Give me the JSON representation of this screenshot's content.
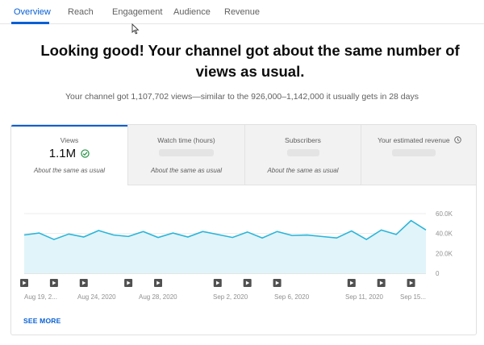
{
  "tabs": [
    {
      "label": "Overview",
      "active": true
    },
    {
      "label": "Reach"
    },
    {
      "label": "Engagement"
    },
    {
      "label": "Audience"
    },
    {
      "label": "Revenue"
    }
  ],
  "headline": "Looking good! Your channel got about the same number of views as usual.",
  "subline": "Your channel got 1,107,702 views—similar to the 926,000–1,142,000 it usually gets in 28 days",
  "metrics": [
    {
      "title": "Views",
      "value": "1.1M",
      "note": "About the same as usual"
    },
    {
      "title": "Watch time (hours)",
      "value": "",
      "note": "About the same as usual"
    },
    {
      "title": "Subscribers",
      "value": "",
      "note": "About the same as usual"
    },
    {
      "title": "Your estimated revenue",
      "value": "",
      "note": ""
    }
  ],
  "see_more": "SEE MORE",
  "colors": {
    "accent": "#065fd4",
    "line": "#2bb5d8",
    "area": "#e1f4fa",
    "check": "#1e8e3e"
  },
  "chart_data": {
    "type": "area",
    "x_ticks": [
      "Aug 19, 2...",
      "Aug 24, 2020",
      "Aug 28, 2020",
      "Sep 2, 2020",
      "Sep 6, 2020",
      "Sep 11, 2020",
      "Sep 15..."
    ],
    "y_ticks": [
      "60.0K",
      "40.0K",
      "20.0K",
      "0"
    ],
    "ylim": [
      0,
      60000
    ],
    "series": [
      {
        "values": [
          38500,
          40500,
          34000,
          39500,
          36500,
          43000,
          38500,
          37000,
          42000,
          36000,
          40500,
          36500,
          42000,
          39000,
          36000,
          41500,
          35500,
          42000,
          38000,
          38500,
          37000,
          35500,
          42500,
          34000,
          43500,
          39000,
          53000,
          43500
        ]
      }
    ],
    "video_markers": [
      0,
      2,
      4,
      7,
      9,
      13,
      15,
      17,
      22,
      24,
      26
    ]
  }
}
